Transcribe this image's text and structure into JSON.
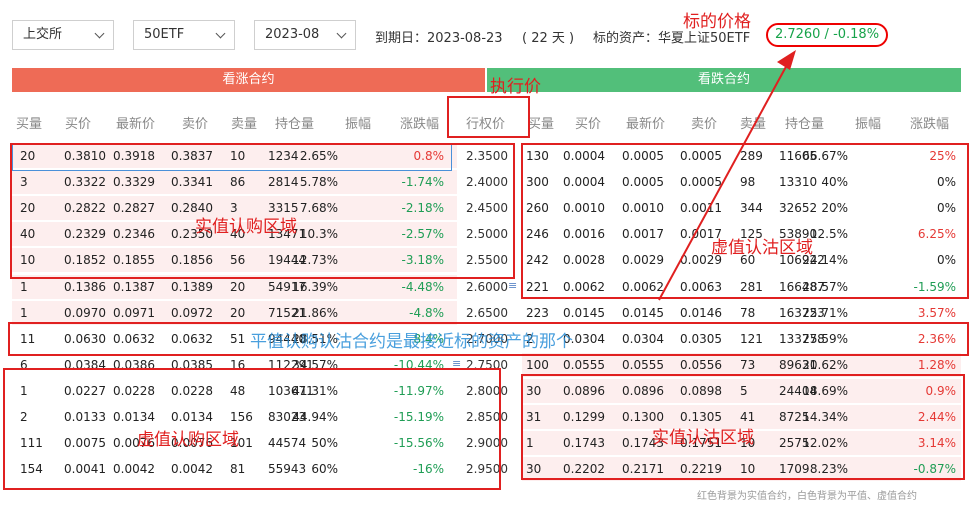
{
  "controls": {
    "exchange": "上交所",
    "underlying": "50ETF",
    "month": "2023-08",
    "expiry": "到期日：2023-08-23",
    "days": "( 22 天 )",
    "underlying_label": "标的资产：华夏上证50ETF",
    "underlying_price": "2.7260 / -0.18%"
  },
  "banners": {
    "call": "看涨合约",
    "put": "看跌合约"
  },
  "headers": {
    "call": [
      "买量",
      "买价",
      "最新价",
      "卖价",
      "卖量",
      "持仓量",
      "振幅",
      "涨跌幅"
    ],
    "strike": "行权价",
    "put": [
      "买量",
      "买价",
      "最新价",
      "卖价",
      "卖量",
      "持仓量",
      "振幅",
      "涨跌幅"
    ]
  },
  "rows": [
    {
      "call": [
        "20",
        "0.3810",
        "0.3918",
        "0.3837",
        "10",
        "1234",
        "2.65%",
        "0.8%"
      ],
      "strike": "2.3500",
      "put": [
        "130",
        "0.0004",
        "0.0005",
        "0.0005",
        "289",
        "11605",
        "66.67%",
        "25%"
      ]
    },
    {
      "call": [
        "3",
        "0.3322",
        "0.3329",
        "0.3341",
        "86",
        "2814",
        "5.78%",
        "-1.74%"
      ],
      "strike": "2.4000",
      "put": [
        "300",
        "0.0004",
        "0.0005",
        "0.0005",
        "98",
        "13310",
        "40%",
        "0%"
      ]
    },
    {
      "call": [
        "20",
        "0.2822",
        "0.2827",
        "0.2840",
        "3",
        "3315",
        "7.68%",
        "-2.18%"
      ],
      "strike": "2.4500",
      "put": [
        "260",
        "0.0010",
        "0.0010",
        "0.0011",
        "344",
        "32652",
        "20%",
        "0%"
      ]
    },
    {
      "call": [
        "40",
        "0.2329",
        "0.2346",
        "0.2350",
        "40",
        "13471",
        "10.3%",
        "-2.57%"
      ],
      "strike": "2.5000",
      "put": [
        "246",
        "0.0016",
        "0.0017",
        "0.0017",
        "125",
        "53890",
        "12.5%",
        "6.25%"
      ]
    },
    {
      "call": [
        "10",
        "0.1852",
        "0.1855",
        "0.1856",
        "56",
        "19444",
        "12.73%",
        "-3.18%"
      ],
      "strike": "2.5500",
      "put": [
        "242",
        "0.0028",
        "0.0029",
        "0.0029",
        "60",
        "106922",
        "24.14%",
        "0%"
      ]
    },
    {
      "call": [
        "1",
        "0.1386",
        "0.1387",
        "0.1389",
        "20",
        "54917",
        "16.39%",
        "-4.48%"
      ],
      "strike": "2.6000",
      "put": [
        "221",
        "0.0062",
        "0.0062",
        "0.0063",
        "281",
        "166487",
        "28.57%",
        "-1.59%"
      ]
    },
    {
      "call": [
        "1",
        "0.0970",
        "0.0971",
        "0.0972",
        "20",
        "71521",
        "21.86%",
        "-4.8%"
      ],
      "strike": "2.6500",
      "put": [
        "223",
        "0.0145",
        "0.0145",
        "0.0146",
        "78",
        "163723",
        "25.71%",
        "3.57%"
      ]
    },
    {
      "call": [
        "11",
        "0.0630",
        "0.0632",
        "0.0632",
        "51",
        "94440",
        "28.51%",
        "-8.4%"
      ],
      "strike": "2.7000",
      "put": [
        "2",
        "0.0304",
        "0.0304",
        "0.0305",
        "121",
        "133778",
        "25.59%",
        "2.36%"
      ]
    },
    {
      "call": [
        "6",
        "0.0384",
        "0.0386",
        "0.0385",
        "16",
        "112291",
        "34.57%",
        "-10.44%"
      ],
      "strike": "2.7500",
      "put": [
        "100",
        "0.0555",
        "0.0555",
        "0.0556",
        "73",
        "89631",
        "20.62%",
        "1.28%"
      ]
    },
    {
      "call": [
        "1",
        "0.0227",
        "0.0228",
        "0.0228",
        "48",
        "103671",
        "41.31%",
        "-11.97%"
      ],
      "strike": "2.8000",
      "put": [
        "30",
        "0.0896",
        "0.0896",
        "0.0898",
        "5",
        "24404",
        "18.69%",
        "0.9%"
      ]
    },
    {
      "call": [
        "2",
        "0.0133",
        "0.0134",
        "0.0134",
        "156",
        "83023",
        "44.94%",
        "-15.19%"
      ],
      "strike": "2.8500",
      "put": [
        "31",
        "0.1299",
        "0.1300",
        "0.1305",
        "41",
        "8725",
        "14.34%",
        "2.44%"
      ]
    },
    {
      "call": [
        "111",
        "0.0075",
        "0.0076",
        "0.0076",
        "101",
        "44574",
        "50%",
        "-15.56%"
      ],
      "strike": "2.9000",
      "put": [
        "1",
        "0.1743",
        "0.1743",
        "0.1751",
        "10",
        "2575",
        "12.02%",
        "3.14%"
      ]
    },
    {
      "call": [
        "154",
        "0.0041",
        "0.0042",
        "0.0042",
        "81",
        "55943",
        "60%",
        "-16%"
      ],
      "strike": "2.9500",
      "put": [
        "30",
        "0.2202",
        "0.2171",
        "0.2219",
        "10",
        "1709",
        "8.23%",
        "-0.87%"
      ]
    }
  ],
  "annotations": {
    "underlying_price": "标的价格",
    "strike": "执行价",
    "itm_call": "实值认购区域",
    "otm_put": "虚值认沽区域",
    "atm": "平值认购认沽合约是最接近标的资产的那个",
    "otm_call": "虚值认购区域",
    "itm_put": "实值认沽区域"
  },
  "footnote": "红色背景为实值合约，白色背景为平值、虚值合约",
  "colors": {
    "call_banner": "#ee6b56",
    "put_banner": "#52bf7a",
    "up": "#e53935",
    "down": "#1f9d55",
    "annotation": "#e02020"
  }
}
